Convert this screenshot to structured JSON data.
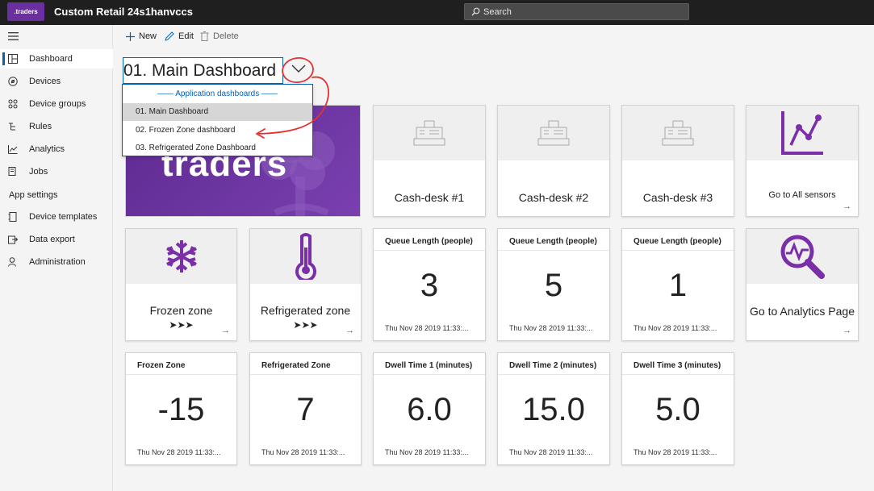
{
  "app": {
    "logo_text": ".traders",
    "title": "Custom Retail 24s1hanvccs",
    "search_placeholder": "Search"
  },
  "sidebar": {
    "items": [
      {
        "label": "Dashboard",
        "icon": "dashboard-icon",
        "active": true
      },
      {
        "label": "Devices",
        "icon": "devices-icon"
      },
      {
        "label": "Device groups",
        "icon": "device-groups-icon"
      },
      {
        "label": "Rules",
        "icon": "rules-icon"
      },
      {
        "label": "Analytics",
        "icon": "analytics-icon"
      },
      {
        "label": "Jobs",
        "icon": "jobs-icon"
      }
    ],
    "section_label": "App settings",
    "settings_items": [
      {
        "label": "Device templates",
        "icon": "device-templates-icon"
      },
      {
        "label": "Data export",
        "icon": "data-export-icon"
      },
      {
        "label": "Administration",
        "icon": "administration-icon"
      }
    ]
  },
  "toolbar": {
    "new_label": "New",
    "edit_label": "Edit",
    "delete_label": "Delete"
  },
  "dashboard": {
    "title": "01. Main Dashboard",
    "dropdown": {
      "header": "—— Application dashboards ——",
      "options": [
        {
          "label": "01. Main Dashboard",
          "selected": true
        },
        {
          "label": "02. Frozen Zone dashboard"
        },
        {
          "label": "03. Refrigerated Zone Dashboard"
        }
      ]
    }
  },
  "tiles": {
    "brand_text": "traders",
    "cash_desks": [
      "Cash-desk #1",
      "Cash-desk #2",
      "Cash-desk #3"
    ],
    "all_sensors": "Go to All sensors",
    "frozen_zone": {
      "label": "Frozen zone",
      "chevrons": "➤➤➤"
    },
    "refrigerated_zone": {
      "label": "Refrigerated zone",
      "chevrons": "➤➤➤"
    },
    "analytics_page": "Go to Analytics Page",
    "arrow": "→",
    "queue": [
      {
        "title": "Queue Length (people)",
        "value": "3",
        "time": "Thu Nov 28 2019 11:33:..."
      },
      {
        "title": "Queue Length (people)",
        "value": "5",
        "time": "Thu Nov 28 2019 11:33:..."
      },
      {
        "title": "Queue Length (people)",
        "value": "1",
        "time": "Thu Nov 28 2019 11:33:..."
      }
    ],
    "kpis": [
      {
        "title": "Frozen Zone",
        "value": "-15",
        "time": "Thu Nov 28 2019 11:33:..."
      },
      {
        "title": "Refrigerated Zone",
        "value": "7",
        "time": "Thu Nov 28 2019 11:33:..."
      },
      {
        "title": "Dwell Time 1 (minutes)",
        "value": "6.0",
        "time": "Thu Nov 28 2019 11:33:..."
      },
      {
        "title": "Dwell Time 2 (minutes)",
        "value": "15.0",
        "time": "Thu Nov 28 2019 11:33:..."
      },
      {
        "title": "Dwell Time 3 (minutes)",
        "value": "5.0",
        "time": "Thu Nov 28 2019 11:33:..."
      }
    ]
  },
  "colors": {
    "brand_purple": "#6b2fa0",
    "accent_blue": "#0063b1",
    "annotation_red": "#e53030"
  }
}
